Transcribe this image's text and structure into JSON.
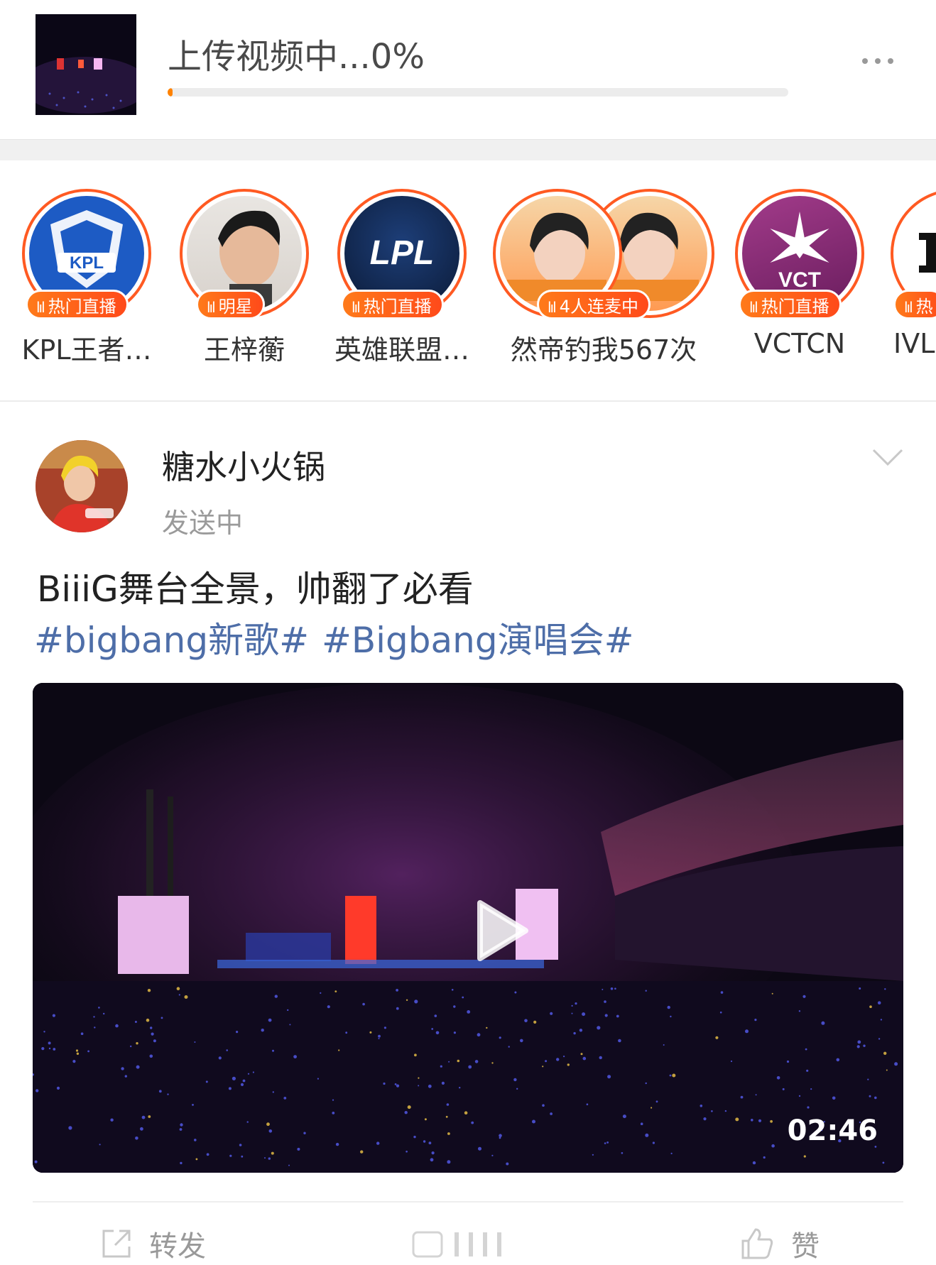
{
  "upload": {
    "title": "上传视频中...0%",
    "progress_percent": 0
  },
  "live": {
    "items": [
      {
        "badge": "热门直播",
        "label": "KPL王者…",
        "avatar_text": "KPL"
      },
      {
        "badge": "明星",
        "label": "王梓蘅"
      },
      {
        "badge": "热门直播",
        "label": "英雄联盟…",
        "avatar_text": "LPL"
      },
      {
        "badge": "4人连麦中",
        "label": "然帝钓我567次"
      },
      {
        "badge": "热门直播",
        "label": "VCTCN",
        "avatar_text": "VCT"
      },
      {
        "badge": "热",
        "label": "IVL"
      }
    ]
  },
  "post": {
    "username": "糖水小火锅",
    "status": "发送中",
    "text": "BiiiG舞台全景，帅翻了必看",
    "tags": [
      "#bigbang新歌#",
      "#Bigbang演唱会#"
    ],
    "video": {
      "duration": "02:46"
    },
    "actions": {
      "repost": "转发",
      "like": "赞"
    }
  },
  "colors": {
    "accent": "#ff8200",
    "live_ring": "#ff5a22",
    "tag_link": "#4e6ea8"
  },
  "icons": [
    "more-icon",
    "bars-icon",
    "chevron-down-icon",
    "play-icon",
    "share-icon",
    "comment-icon",
    "like-icon"
  ]
}
